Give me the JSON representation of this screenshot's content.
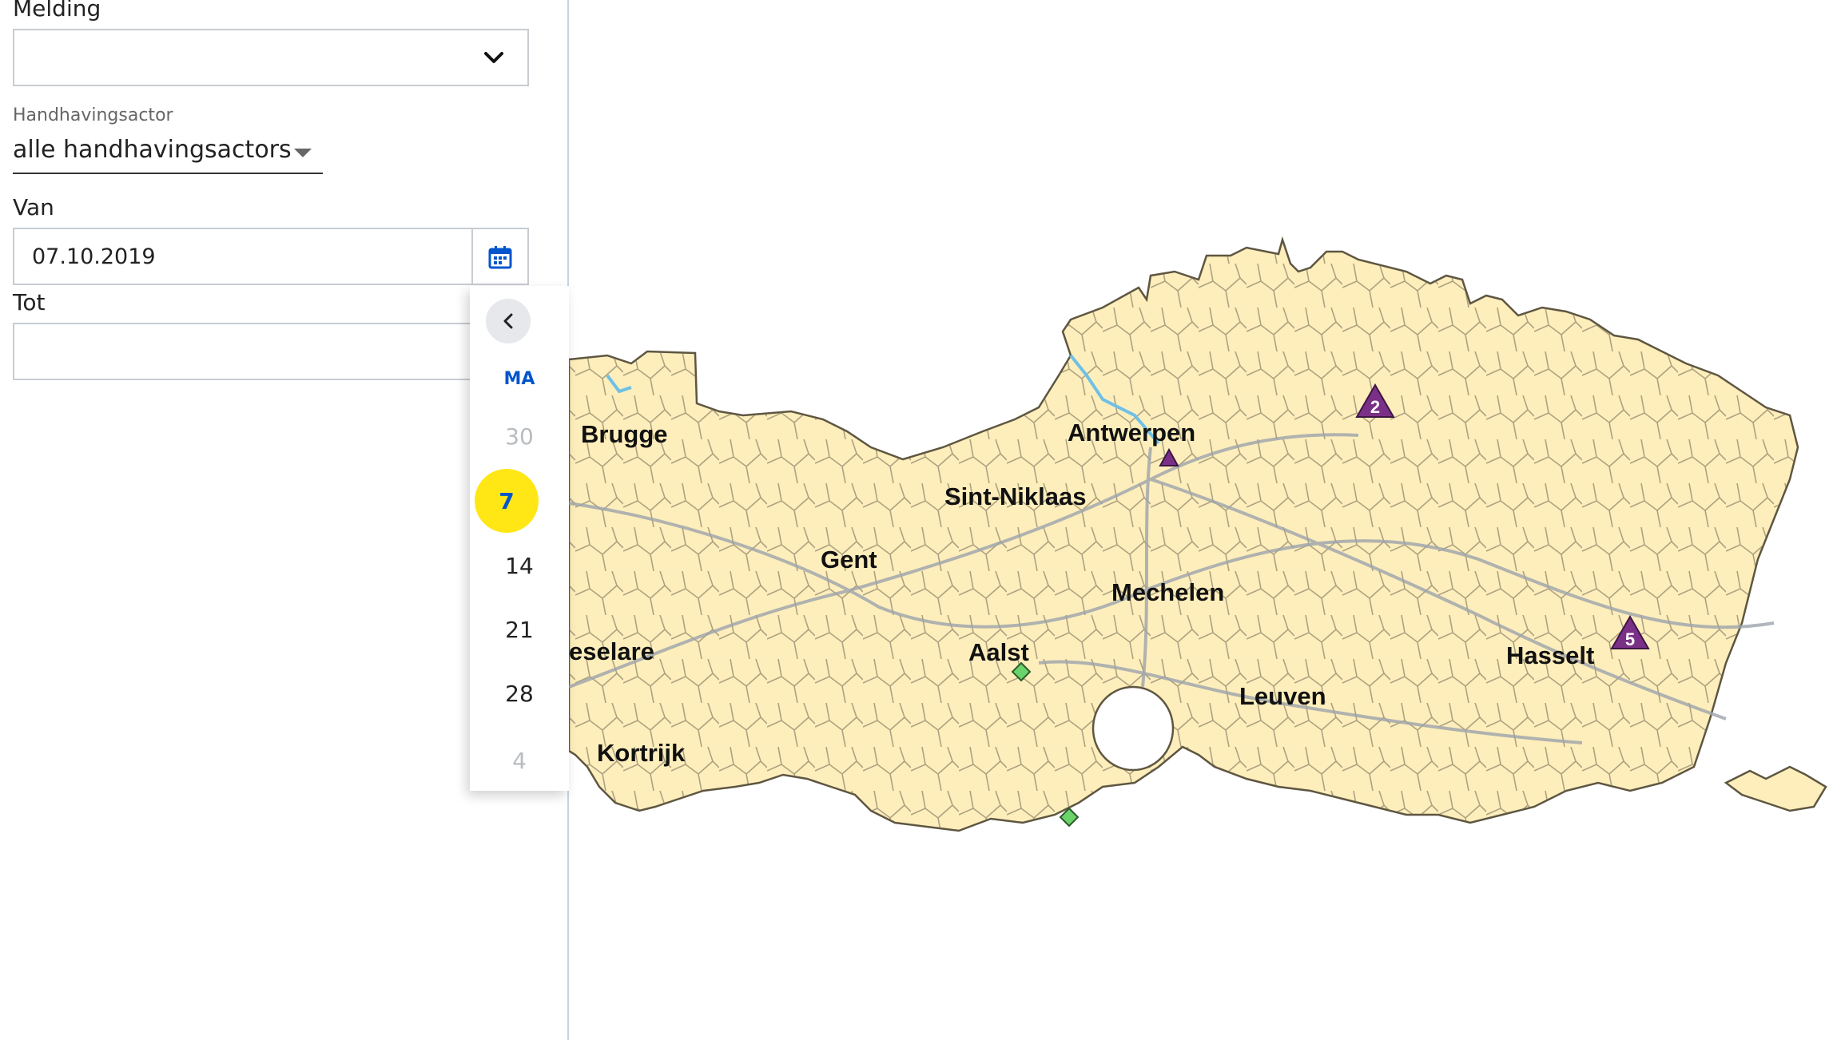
{
  "filters": {
    "melding": {
      "label": "Melding",
      "value": ""
    },
    "handhavingsactor": {
      "label": "Handhavingsactor",
      "value": "alle handhavingsactors"
    },
    "van": {
      "label": "Van",
      "value": "07.10.2019"
    },
    "tot": {
      "label": "Tot",
      "value": ""
    }
  },
  "calendar": {
    "weekday_header": "MA",
    "days": [
      "30",
      "7",
      "14",
      "21",
      "28",
      "4"
    ],
    "selected_day": "7",
    "selected_color": "#ffe615",
    "accent_color": "#0055cc",
    "back_icon": "chevron-left-icon"
  },
  "map": {
    "fill_color": "#fdeebb",
    "cities": [
      "Brugge",
      "Antwerpen",
      "Sint-Niklaas",
      "Gent",
      "Mechelen",
      "Aalst",
      "eselare",
      "Hasselt",
      "Leuven",
      "Kortrijk"
    ],
    "markers": [
      {
        "type": "triangle-cluster",
        "count": "2",
        "color": "#7b3087"
      },
      {
        "type": "triangle",
        "count": "",
        "color": "#7b3087"
      },
      {
        "type": "triangle-cluster",
        "count": "5",
        "color": "#7b3087"
      },
      {
        "type": "diamond",
        "color": "#6ad36a"
      },
      {
        "type": "diamond",
        "color": "#6ad36a"
      }
    ]
  }
}
